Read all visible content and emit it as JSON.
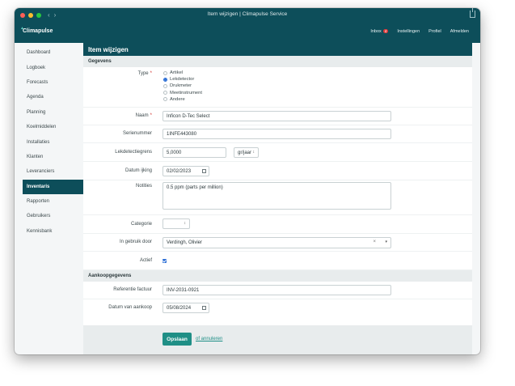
{
  "window": {
    "title": "Item wijzigen | Climapulse Service"
  },
  "app": {
    "logo": "Climapulse"
  },
  "topnav": [
    {
      "label": "Inbox",
      "badge": "4"
    },
    {
      "label": "Instellingen"
    },
    {
      "label": "Profiel"
    },
    {
      "label": "Afmelden"
    }
  ],
  "sidebar": {
    "items": [
      {
        "label": "Dashboard"
      },
      {
        "label": "Logboek"
      },
      {
        "label": "Forecasts"
      },
      {
        "label": "Agenda"
      },
      {
        "label": "Planning"
      },
      {
        "label": "Koelmiddelen"
      },
      {
        "label": "Installaties"
      },
      {
        "label": "Klanten"
      },
      {
        "label": "Leveranciers"
      },
      {
        "label": "Inventaris"
      },
      {
        "label": "Rapporten"
      },
      {
        "label": "Gebruikers"
      },
      {
        "label": "Kennisbank"
      }
    ],
    "active": "Inventaris"
  },
  "page": {
    "title": "Item wijzigen"
  },
  "sections": {
    "gegevens": "Gegevens",
    "aankoop": "Aankoopgegevens"
  },
  "form": {
    "type": {
      "label": "Type",
      "options": [
        "Artikel",
        "Lekdetector",
        "Drukmeter",
        "Meetinstrument",
        "Andere"
      ],
      "selected": "Lekdetector"
    },
    "naam": {
      "label": "Naam",
      "value": "Inficon D-Tec Select"
    },
    "serienummer": {
      "label": "Serienummer",
      "value": "1INFE443080"
    },
    "lekdetectiegrens": {
      "label": "Lekdetectiegrens",
      "value": "5,0000",
      "unit": "gr/jaar"
    },
    "datum_ijking": {
      "label": "Datum ijking",
      "value": "02/02/2023"
    },
    "notities": {
      "label": "Notities",
      "value": "0.5 ppm (parts per million)"
    },
    "categorie": {
      "label": "Categorie",
      "value": ""
    },
    "in_gebruik_door": {
      "label": "In gebruik door",
      "value": "Verdingh, Olivier"
    },
    "actief": {
      "label": "Actief",
      "checked": true
    },
    "referentie_factuur": {
      "label": "Referentie factuur",
      "value": "INV-2031-0921"
    },
    "datum_aankoop": {
      "label": "Datum van aankoop",
      "value": "05/08/2024"
    }
  },
  "actions": {
    "save": "Opslaan",
    "cancel": "of annuleren"
  },
  "colors": {
    "brand": "#0d4e5a",
    "accent": "#1f8f86",
    "active_check": "#2d6fd6",
    "badge": "#e03b3b"
  }
}
